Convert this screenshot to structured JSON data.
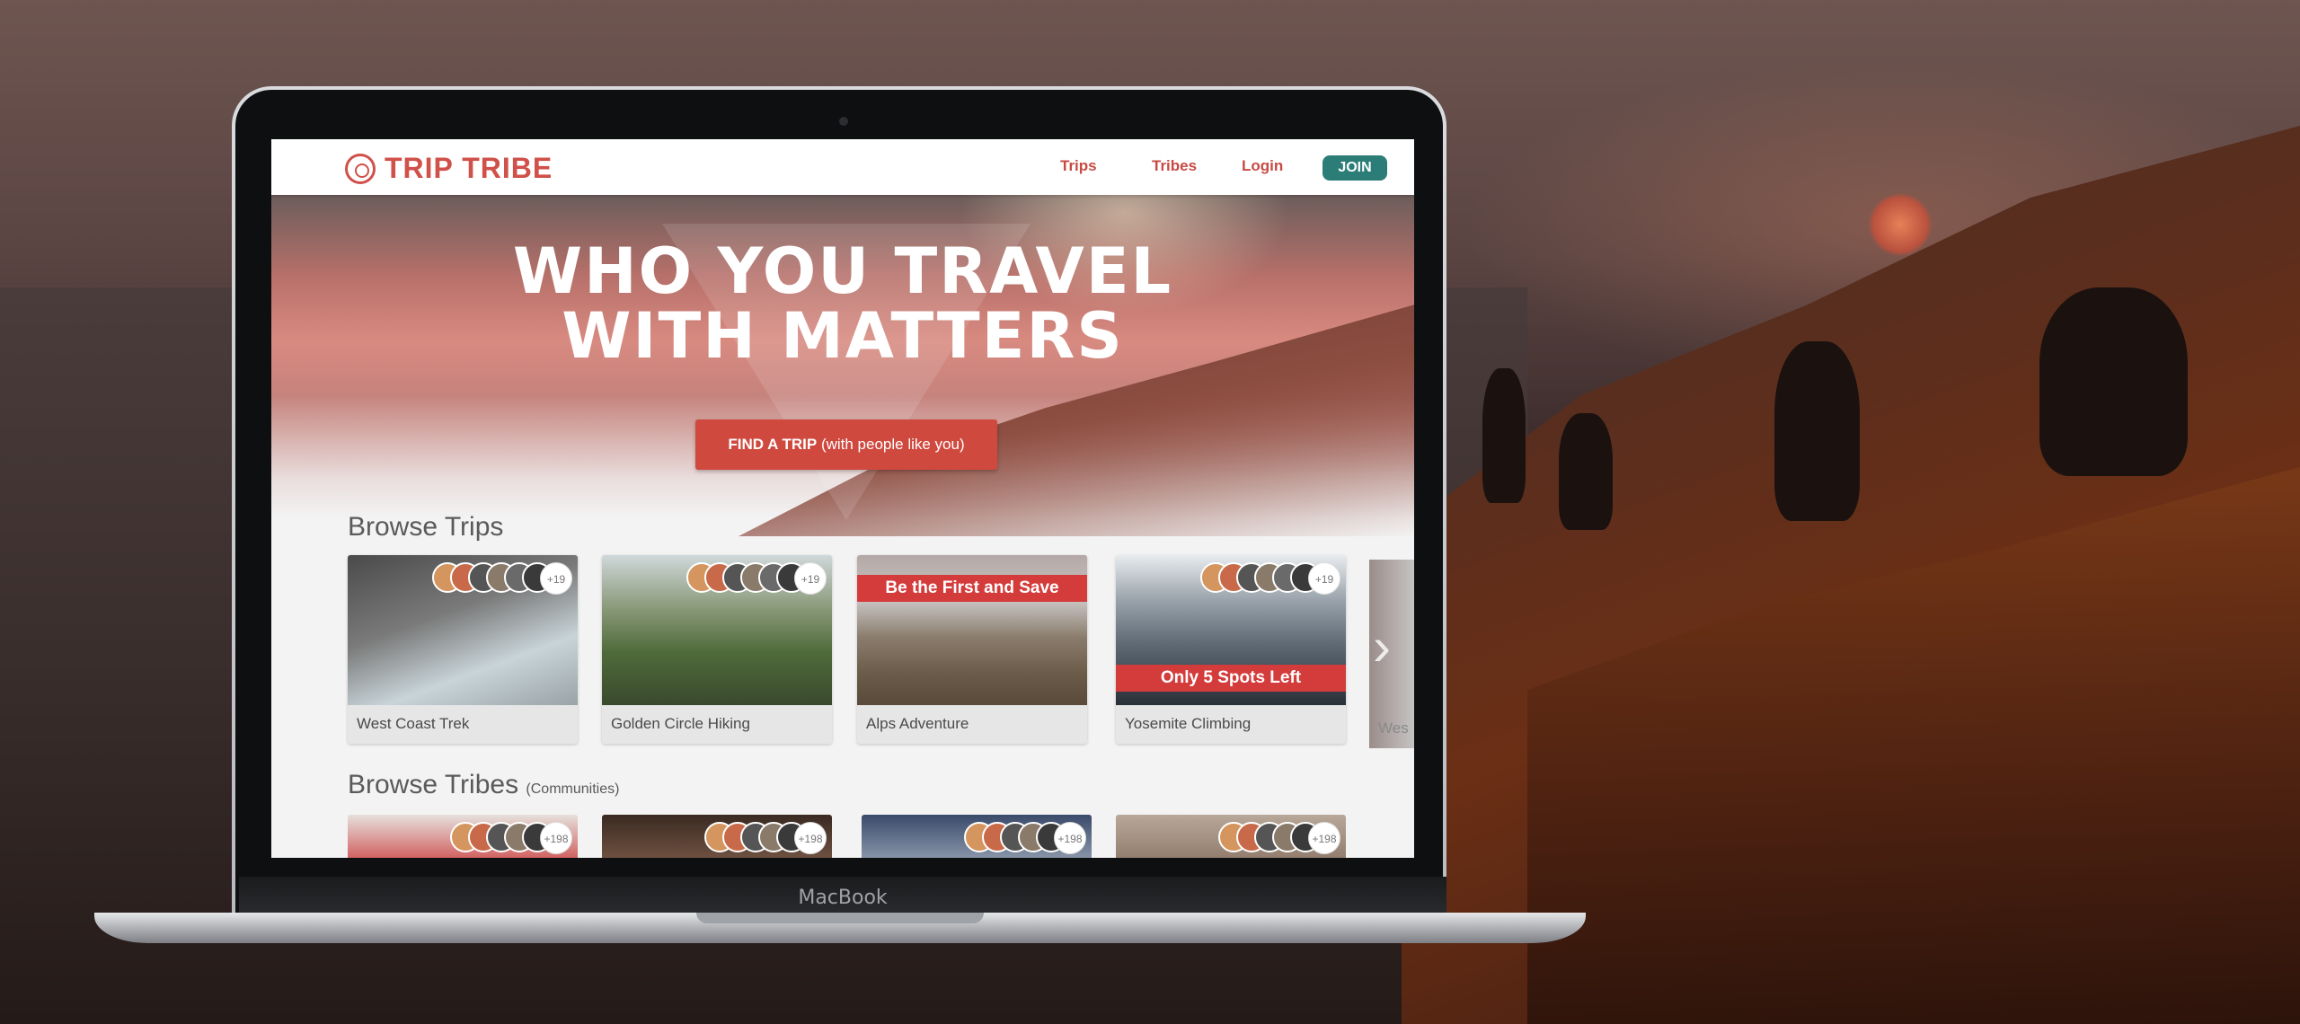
{
  "device": {
    "label": "MacBook"
  },
  "site": {
    "brand": "TRIP TRIBE",
    "nav": {
      "trips": "Trips",
      "tribes": "Tribes",
      "login": "Login",
      "join": "JOIN"
    },
    "hero": {
      "line1": "WHO YOU TRAVEL",
      "line2": "WITH MATTERS",
      "cta_bold": "FIND A TRIP",
      "cta_rest": " (with people like you)"
    },
    "browse_trips": {
      "title": "Browse Trips",
      "cards": [
        {
          "label": "West Coast Trek",
          "count": "+19",
          "banner": ""
        },
        {
          "label": "Golden Circle Hiking",
          "count": "+19",
          "banner": ""
        },
        {
          "label": "Alps Adventure",
          "count": "",
          "banner": "Be the First and Save"
        },
        {
          "label": "Yosemite Climbing",
          "count": "+19",
          "banner": "Only 5 Spots Left"
        }
      ],
      "peek_label": "Wes"
    },
    "browse_tribes": {
      "title": "Browse Tribes",
      "subtitle": "(Communities)",
      "counts": [
        "+198",
        "+198",
        "+198",
        "+198"
      ]
    }
  },
  "colors": {
    "brand_red": "#d0504a",
    "join_teal": "#2c7d78",
    "banner_red": "#d43b3b"
  }
}
